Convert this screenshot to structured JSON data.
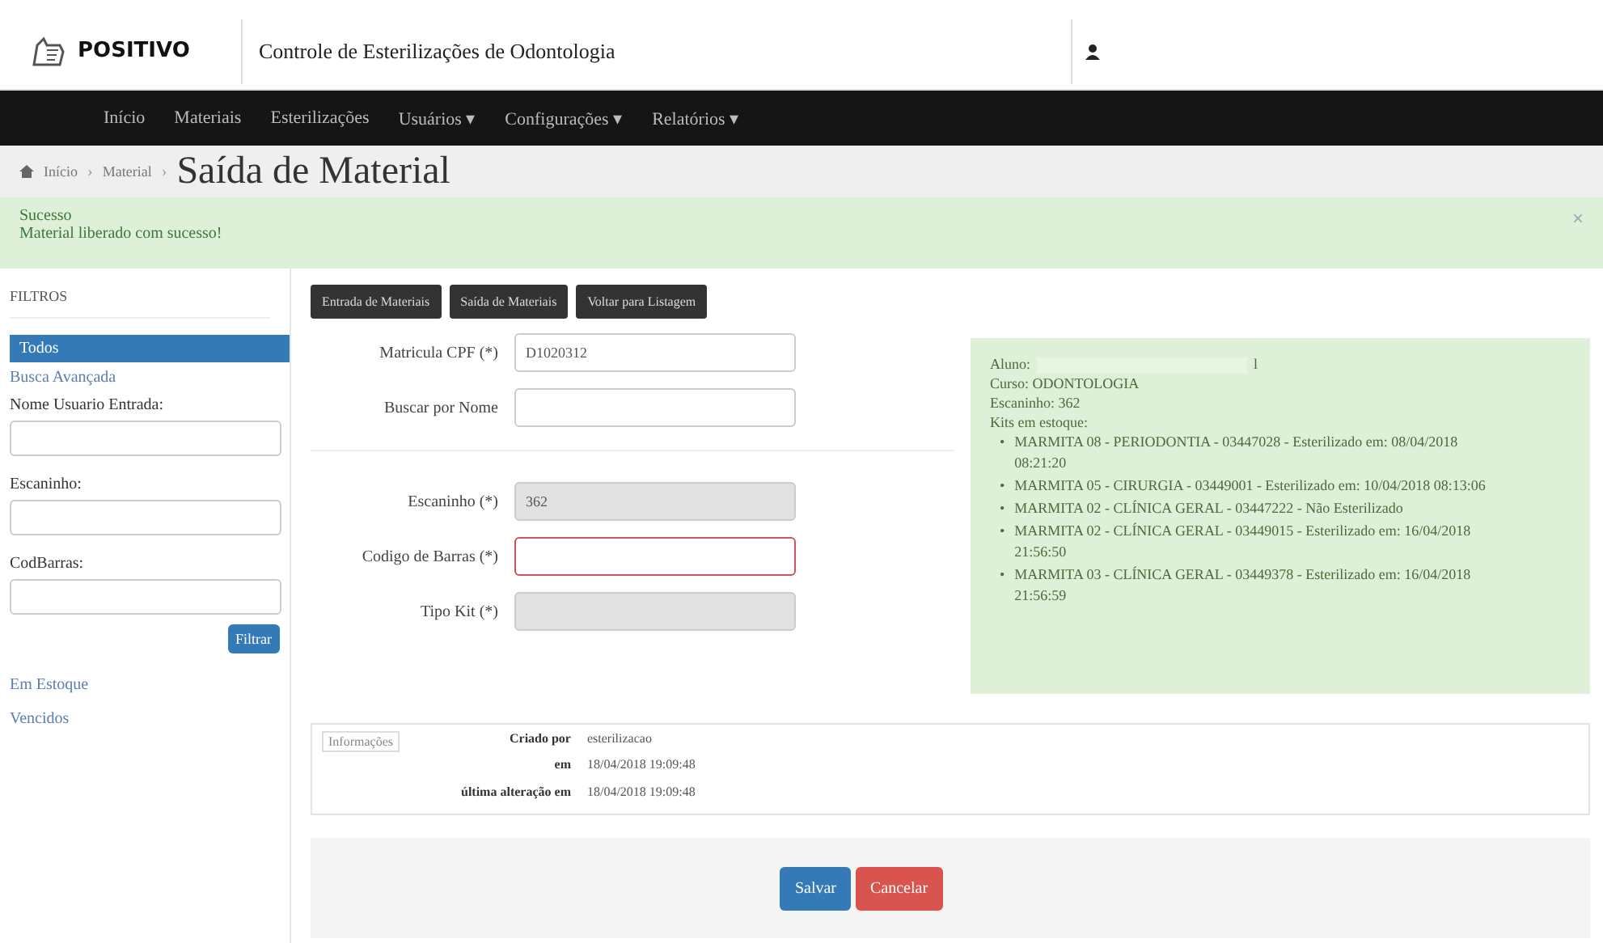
{
  "header": {
    "brand": "POSITIVO",
    "title": "Controle de Esterilizações de Odontologia"
  },
  "nav": [
    {
      "label": "Início"
    },
    {
      "label": "Materiais"
    },
    {
      "label": "Esterilizações"
    },
    {
      "label": "Usuários",
      "caret": "▾"
    },
    {
      "label": "Configurações",
      "caret": "▾"
    },
    {
      "label": "Relatórios",
      "caret": "▾"
    }
  ],
  "breadcrumb": {
    "items": [
      {
        "label": "Início",
        "separator": "›"
      },
      {
        "label": "Material",
        "separator": "›"
      }
    ],
    "current": "Saída de Material"
  },
  "alert": {
    "title": "Sucesso",
    "message": "Material liberado com sucesso!",
    "close": "×"
  },
  "sidebar": {
    "heading": "FILTROS",
    "items": [
      {
        "label": "Todos",
        "selected": true
      }
    ],
    "advanced_link": "Busca Avançada",
    "fields": [
      {
        "label": "Nome Usuario Entrada:"
      },
      {
        "label": "Escaninho:"
      },
      {
        "label": "CodBarras:"
      }
    ],
    "filter_button": "Filtrar",
    "links": [
      "Em Estoque",
      "Vencidos"
    ]
  },
  "actions": [
    "Entrada de Materiais",
    "Saída de Materiais",
    "Voltar para Listagem"
  ],
  "form": [
    {
      "label": "Matricula CPF (*)",
      "value": "D1020312",
      "disabled": false,
      "error": false,
      "group_end": false
    },
    {
      "label": "Buscar por Nome",
      "disabled": false,
      "error": false,
      "group_end": true
    },
    {
      "label": "Escaninho (*)",
      "value": "362",
      "disabled": true,
      "error": false,
      "group_end": false
    },
    {
      "label": "Codigo de Barras (*)",
      "disabled": false,
      "error": true,
      "group_end": false
    },
    {
      "label": "Tipo Kit (*)",
      "disabled": true,
      "error": false,
      "group_end": false
    }
  ],
  "student_panel": {
    "aluno_label": "Aluno:",
    "aluno_value": "l",
    "lines": [
      "Curso: ODONTOLOGIA",
      "Escaninho: 362",
      "Kits em estoque:"
    ],
    "kits": [
      {
        "bullet": "•",
        "text": "MARMITA 08 - PERIODONTIA - 03447028 - Esterilizado em: 08/04/2018 08:21:20"
      },
      {
        "bullet": "•",
        "text": "MARMITA 05 - CIRURGIA - 03449001 - Esterilizado em: 10/04/2018 08:13:06"
      },
      {
        "bullet": "•",
        "text": "MARMITA 02 - CLÍNICA GERAL - 03447222 - Não Esterilizado"
      },
      {
        "bullet": "•",
        "text": "MARMITA 02 - CLÍNICA GERAL - 03449015 - Esterilizado em: 16/04/2018 21:56:50"
      },
      {
        "bullet": "•",
        "text": "MARMITA 03 - CLÍNICA GERAL - 03449378 - Esterilizado em: 16/04/2018 21:56:59"
      }
    ]
  },
  "info": {
    "tag": "Informações",
    "rows": [
      {
        "label": "Criado por",
        "value": "esterilizacao"
      },
      {
        "label": "em",
        "value": "18/04/2018 19:09:48"
      },
      {
        "label": "última alteração em",
        "value": "18/04/2018 19:09:48"
      }
    ]
  },
  "footer_buttons": [
    {
      "label": "Salvar",
      "kind": "primary"
    },
    {
      "label": "Cancelar",
      "kind": "danger"
    }
  ]
}
